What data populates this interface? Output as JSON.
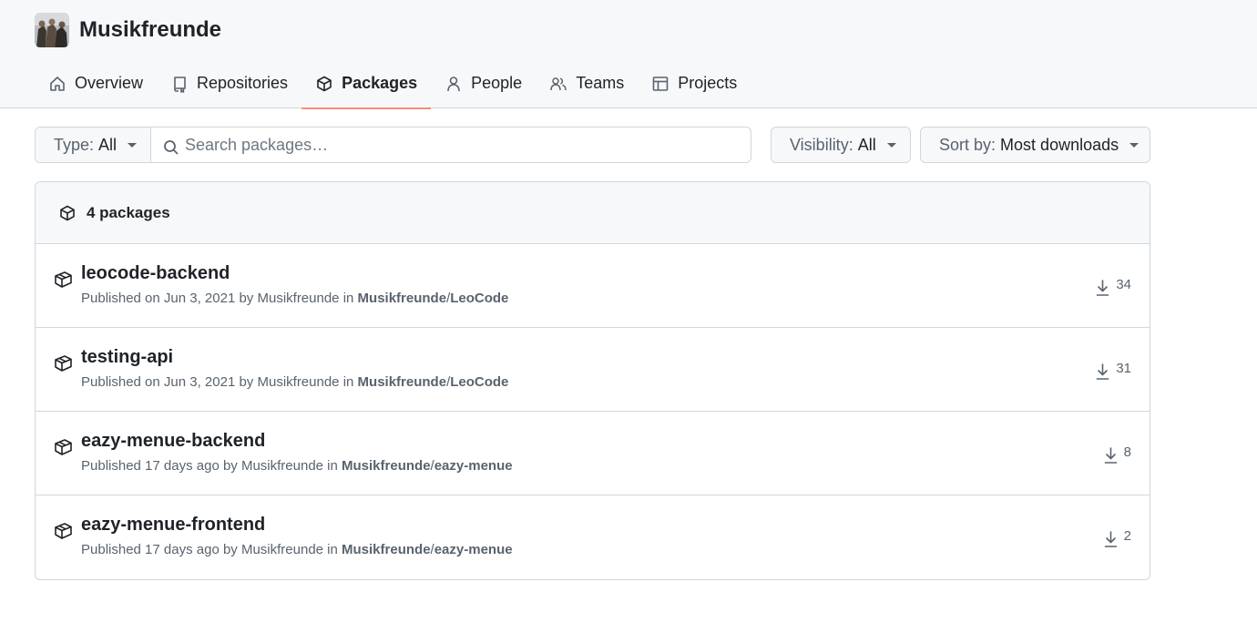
{
  "org": {
    "name": "Musikfreunde"
  },
  "tabs": [
    {
      "label": "Overview",
      "icon": "home-icon"
    },
    {
      "label": "Repositories",
      "icon": "repo-icon"
    },
    {
      "label": "Packages",
      "icon": "package-icon",
      "active": true
    },
    {
      "label": "People",
      "icon": "person-icon"
    },
    {
      "label": "Teams",
      "icon": "people-icon"
    },
    {
      "label": "Projects",
      "icon": "table-icon"
    }
  ],
  "filters": {
    "type_label": "Type:",
    "type_value": "All",
    "search_placeholder": "Search packages…",
    "visibility_label": "Visibility:",
    "visibility_value": "All",
    "sort_label": "Sort by:",
    "sort_value": "Most downloads"
  },
  "list": {
    "count_label": "4 packages",
    "packages": [
      {
        "name": "leocode-backend",
        "published": "Published on Jun 3, 2021 by Musikfreunde in",
        "owner": "Musikfreunde",
        "repo": "LeoCode",
        "downloads": "34"
      },
      {
        "name": "testing-api",
        "published": "Published on Jun 3, 2021 by Musikfreunde in",
        "owner": "Musikfreunde",
        "repo": "LeoCode",
        "downloads": "31"
      },
      {
        "name": "eazy-menue-backend",
        "published": "Published 17 days ago by Musikfreunde in",
        "owner": "Musikfreunde",
        "repo": "eazy-menue",
        "downloads": "8"
      },
      {
        "name": "eazy-menue-frontend",
        "published": "Published 17 days ago by Musikfreunde in",
        "owner": "Musikfreunde",
        "repo": "eazy-menue",
        "downloads": "2"
      }
    ]
  },
  "colors": {
    "accent_underline": "#fd8c73",
    "border": "#d0d7de",
    "header_bg": "#f6f8fa",
    "muted": "#59636e"
  }
}
